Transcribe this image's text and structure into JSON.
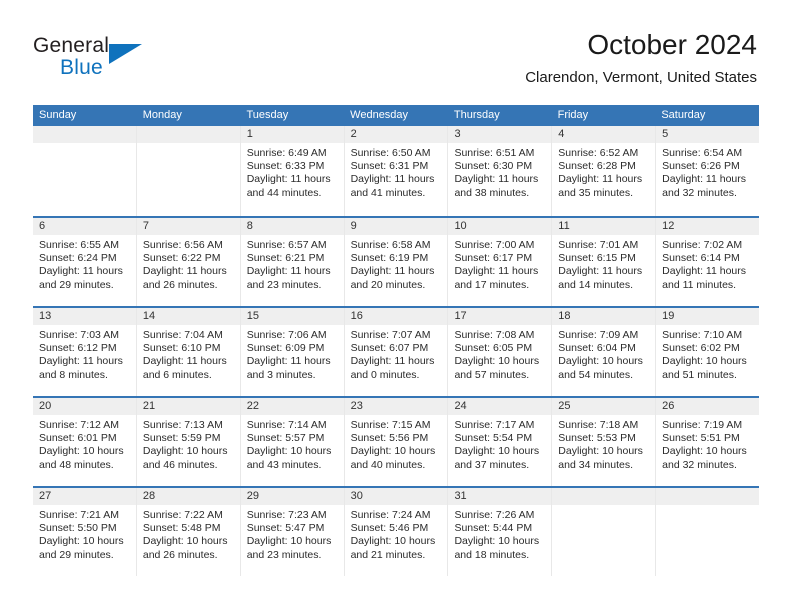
{
  "brand": {
    "word_one": "General",
    "word_two": "Blue",
    "flag_icon": "triangle-flag-icon"
  },
  "header": {
    "month_title": "October 2024",
    "location": "Clarendon, Vermont, United States"
  },
  "calendar": {
    "weekday_headers": [
      "Sunday",
      "Monday",
      "Tuesday",
      "Wednesday",
      "Thursday",
      "Friday",
      "Saturday"
    ],
    "accent_color": "#3575b5",
    "daynum_band_color": "#efefef",
    "weeks": [
      [
        {
          "day": "",
          "lines": []
        },
        {
          "day": "",
          "lines": []
        },
        {
          "day": "1",
          "lines": [
            "Sunrise: 6:49 AM",
            "Sunset: 6:33 PM",
            "Daylight: 11 hours",
            "and 44 minutes."
          ]
        },
        {
          "day": "2",
          "lines": [
            "Sunrise: 6:50 AM",
            "Sunset: 6:31 PM",
            "Daylight: 11 hours",
            "and 41 minutes."
          ]
        },
        {
          "day": "3",
          "lines": [
            "Sunrise: 6:51 AM",
            "Sunset: 6:30 PM",
            "Daylight: 11 hours",
            "and 38 minutes."
          ]
        },
        {
          "day": "4",
          "lines": [
            "Sunrise: 6:52 AM",
            "Sunset: 6:28 PM",
            "Daylight: 11 hours",
            "and 35 minutes."
          ]
        },
        {
          "day": "5",
          "lines": [
            "Sunrise: 6:54 AM",
            "Sunset: 6:26 PM",
            "Daylight: 11 hours",
            "and 32 minutes."
          ]
        }
      ],
      [
        {
          "day": "6",
          "lines": [
            "Sunrise: 6:55 AM",
            "Sunset: 6:24 PM",
            "Daylight: 11 hours",
            "and 29 minutes."
          ]
        },
        {
          "day": "7",
          "lines": [
            "Sunrise: 6:56 AM",
            "Sunset: 6:22 PM",
            "Daylight: 11 hours",
            "and 26 minutes."
          ]
        },
        {
          "day": "8",
          "lines": [
            "Sunrise: 6:57 AM",
            "Sunset: 6:21 PM",
            "Daylight: 11 hours",
            "and 23 minutes."
          ]
        },
        {
          "day": "9",
          "lines": [
            "Sunrise: 6:58 AM",
            "Sunset: 6:19 PM",
            "Daylight: 11 hours",
            "and 20 minutes."
          ]
        },
        {
          "day": "10",
          "lines": [
            "Sunrise: 7:00 AM",
            "Sunset: 6:17 PM",
            "Daylight: 11 hours",
            "and 17 minutes."
          ]
        },
        {
          "day": "11",
          "lines": [
            "Sunrise: 7:01 AM",
            "Sunset: 6:15 PM",
            "Daylight: 11 hours",
            "and 14 minutes."
          ]
        },
        {
          "day": "12",
          "lines": [
            "Sunrise: 7:02 AM",
            "Sunset: 6:14 PM",
            "Daylight: 11 hours",
            "and 11 minutes."
          ]
        }
      ],
      [
        {
          "day": "13",
          "lines": [
            "Sunrise: 7:03 AM",
            "Sunset: 6:12 PM",
            "Daylight: 11 hours",
            "and 8 minutes."
          ]
        },
        {
          "day": "14",
          "lines": [
            "Sunrise: 7:04 AM",
            "Sunset: 6:10 PM",
            "Daylight: 11 hours",
            "and 6 minutes."
          ]
        },
        {
          "day": "15",
          "lines": [
            "Sunrise: 7:06 AM",
            "Sunset: 6:09 PM",
            "Daylight: 11 hours",
            "and 3 minutes."
          ]
        },
        {
          "day": "16",
          "lines": [
            "Sunrise: 7:07 AM",
            "Sunset: 6:07 PM",
            "Daylight: 11 hours",
            "and 0 minutes."
          ]
        },
        {
          "day": "17",
          "lines": [
            "Sunrise: 7:08 AM",
            "Sunset: 6:05 PM",
            "Daylight: 10 hours",
            "and 57 minutes."
          ]
        },
        {
          "day": "18",
          "lines": [
            "Sunrise: 7:09 AM",
            "Sunset: 6:04 PM",
            "Daylight: 10 hours",
            "and 54 minutes."
          ]
        },
        {
          "day": "19",
          "lines": [
            "Sunrise: 7:10 AM",
            "Sunset: 6:02 PM",
            "Daylight: 10 hours",
            "and 51 minutes."
          ]
        }
      ],
      [
        {
          "day": "20",
          "lines": [
            "Sunrise: 7:12 AM",
            "Sunset: 6:01 PM",
            "Daylight: 10 hours",
            "and 48 minutes."
          ]
        },
        {
          "day": "21",
          "lines": [
            "Sunrise: 7:13 AM",
            "Sunset: 5:59 PM",
            "Daylight: 10 hours",
            "and 46 minutes."
          ]
        },
        {
          "day": "22",
          "lines": [
            "Sunrise: 7:14 AM",
            "Sunset: 5:57 PM",
            "Daylight: 10 hours",
            "and 43 minutes."
          ]
        },
        {
          "day": "23",
          "lines": [
            "Sunrise: 7:15 AM",
            "Sunset: 5:56 PM",
            "Daylight: 10 hours",
            "and 40 minutes."
          ]
        },
        {
          "day": "24",
          "lines": [
            "Sunrise: 7:17 AM",
            "Sunset: 5:54 PM",
            "Daylight: 10 hours",
            "and 37 minutes."
          ]
        },
        {
          "day": "25",
          "lines": [
            "Sunrise: 7:18 AM",
            "Sunset: 5:53 PM",
            "Daylight: 10 hours",
            "and 34 minutes."
          ]
        },
        {
          "day": "26",
          "lines": [
            "Sunrise: 7:19 AM",
            "Sunset: 5:51 PM",
            "Daylight: 10 hours",
            "and 32 minutes."
          ]
        }
      ],
      [
        {
          "day": "27",
          "lines": [
            "Sunrise: 7:21 AM",
            "Sunset: 5:50 PM",
            "Daylight: 10 hours",
            "and 29 minutes."
          ]
        },
        {
          "day": "28",
          "lines": [
            "Sunrise: 7:22 AM",
            "Sunset: 5:48 PM",
            "Daylight: 10 hours",
            "and 26 minutes."
          ]
        },
        {
          "day": "29",
          "lines": [
            "Sunrise: 7:23 AM",
            "Sunset: 5:47 PM",
            "Daylight: 10 hours",
            "and 23 minutes."
          ]
        },
        {
          "day": "30",
          "lines": [
            "Sunrise: 7:24 AM",
            "Sunset: 5:46 PM",
            "Daylight: 10 hours",
            "and 21 minutes."
          ]
        },
        {
          "day": "31",
          "lines": [
            "Sunrise: 7:26 AM",
            "Sunset: 5:44 PM",
            "Daylight: 10 hours",
            "and 18 minutes."
          ]
        },
        {
          "day": "",
          "lines": []
        },
        {
          "day": "",
          "lines": []
        }
      ]
    ]
  }
}
